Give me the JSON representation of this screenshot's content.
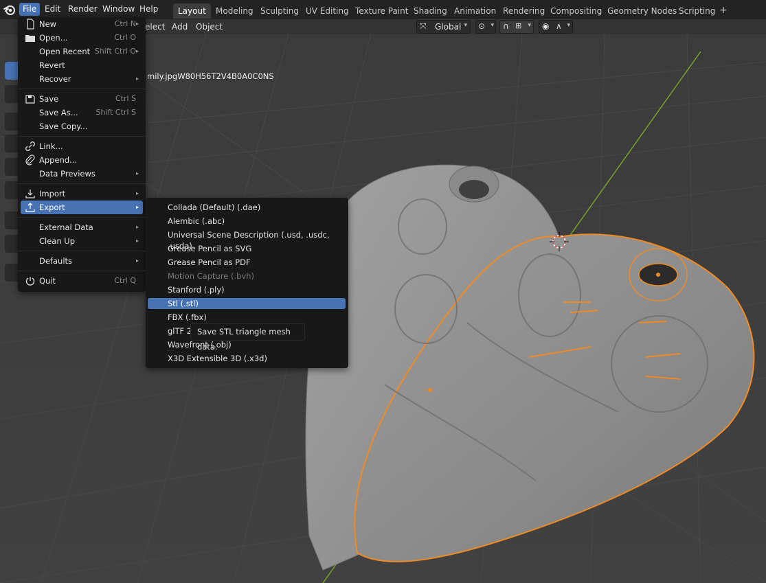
{
  "topbar": {
    "menus": [
      {
        "label": "File"
      },
      {
        "label": "Edit"
      },
      {
        "label": "Render"
      },
      {
        "label": "Window"
      },
      {
        "label": "Help"
      }
    ],
    "workspaces": [
      {
        "label": "Layout"
      },
      {
        "label": "Modeling"
      },
      {
        "label": "Sculpting"
      },
      {
        "label": "UV Editing"
      },
      {
        "label": "Texture Paint"
      },
      {
        "label": "Shading"
      },
      {
        "label": "Animation"
      },
      {
        "label": "Rendering"
      },
      {
        "label": "Compositing"
      },
      {
        "label": "Geometry Nodes"
      },
      {
        "label": "Scripting"
      }
    ],
    "add_tab": "+"
  },
  "viewport_header": {
    "select": "elect",
    "add": "Add",
    "object": "Object",
    "orientation": "Global"
  },
  "viewport": {
    "object_name": "mily.jpgW80H56T2V4B0A0C0NS"
  },
  "file_menu": {
    "items": [
      {
        "label": "New",
        "shortcut": "Ctrl N",
        "icon": "new-file-icon"
      },
      {
        "label": "Open...",
        "shortcut": "Ctrl O",
        "icon": "folder-icon"
      },
      {
        "label": "Open Recent",
        "shortcut": "Shift Ctrl O"
      },
      {
        "label": "Revert"
      },
      {
        "label": "Recover"
      },
      {
        "label": "Save",
        "shortcut": "Ctrl S",
        "icon": "save-icon"
      },
      {
        "label": "Save As...",
        "shortcut": "Shift Ctrl S"
      },
      {
        "label": "Save Copy..."
      },
      {
        "label": "Link...",
        "icon": "link-icon"
      },
      {
        "label": "Append...",
        "icon": "append-icon"
      },
      {
        "label": "Data Previews"
      },
      {
        "label": "Import",
        "icon": "import-icon"
      },
      {
        "label": "Export",
        "icon": "export-icon"
      },
      {
        "label": "External Data"
      },
      {
        "label": "Clean Up"
      },
      {
        "label": "Defaults"
      },
      {
        "label": "Quit",
        "shortcut": "Ctrl Q",
        "icon": "power-icon"
      }
    ]
  },
  "export_menu": {
    "items": [
      {
        "label": "Collada (Default) (.dae)"
      },
      {
        "label": "Alembic (.abc)"
      },
      {
        "label": "Universal Scene Description (.usd, .usdc, .usda)"
      },
      {
        "label": "Grease Pencil as SVG"
      },
      {
        "label": "Grease Pencil as PDF"
      },
      {
        "label": "Motion Capture (.bvh)"
      },
      {
        "label": "Stanford (.ply)"
      },
      {
        "label": "Stl (.stl)"
      },
      {
        "label": "FBX (.fbx)"
      },
      {
        "label": "glTF 2"
      },
      {
        "label": "Wavefront (.obj)"
      },
      {
        "label": "X3D Extensible 3D (.x3d)"
      }
    ]
  },
  "tooltip": {
    "text": "Save STL triangle mesh data."
  },
  "colors": {
    "accent": "#4772b3",
    "selection_outline": "#f08a24",
    "y_axis": "#7aa12b",
    "background": "#3d3d3d"
  }
}
